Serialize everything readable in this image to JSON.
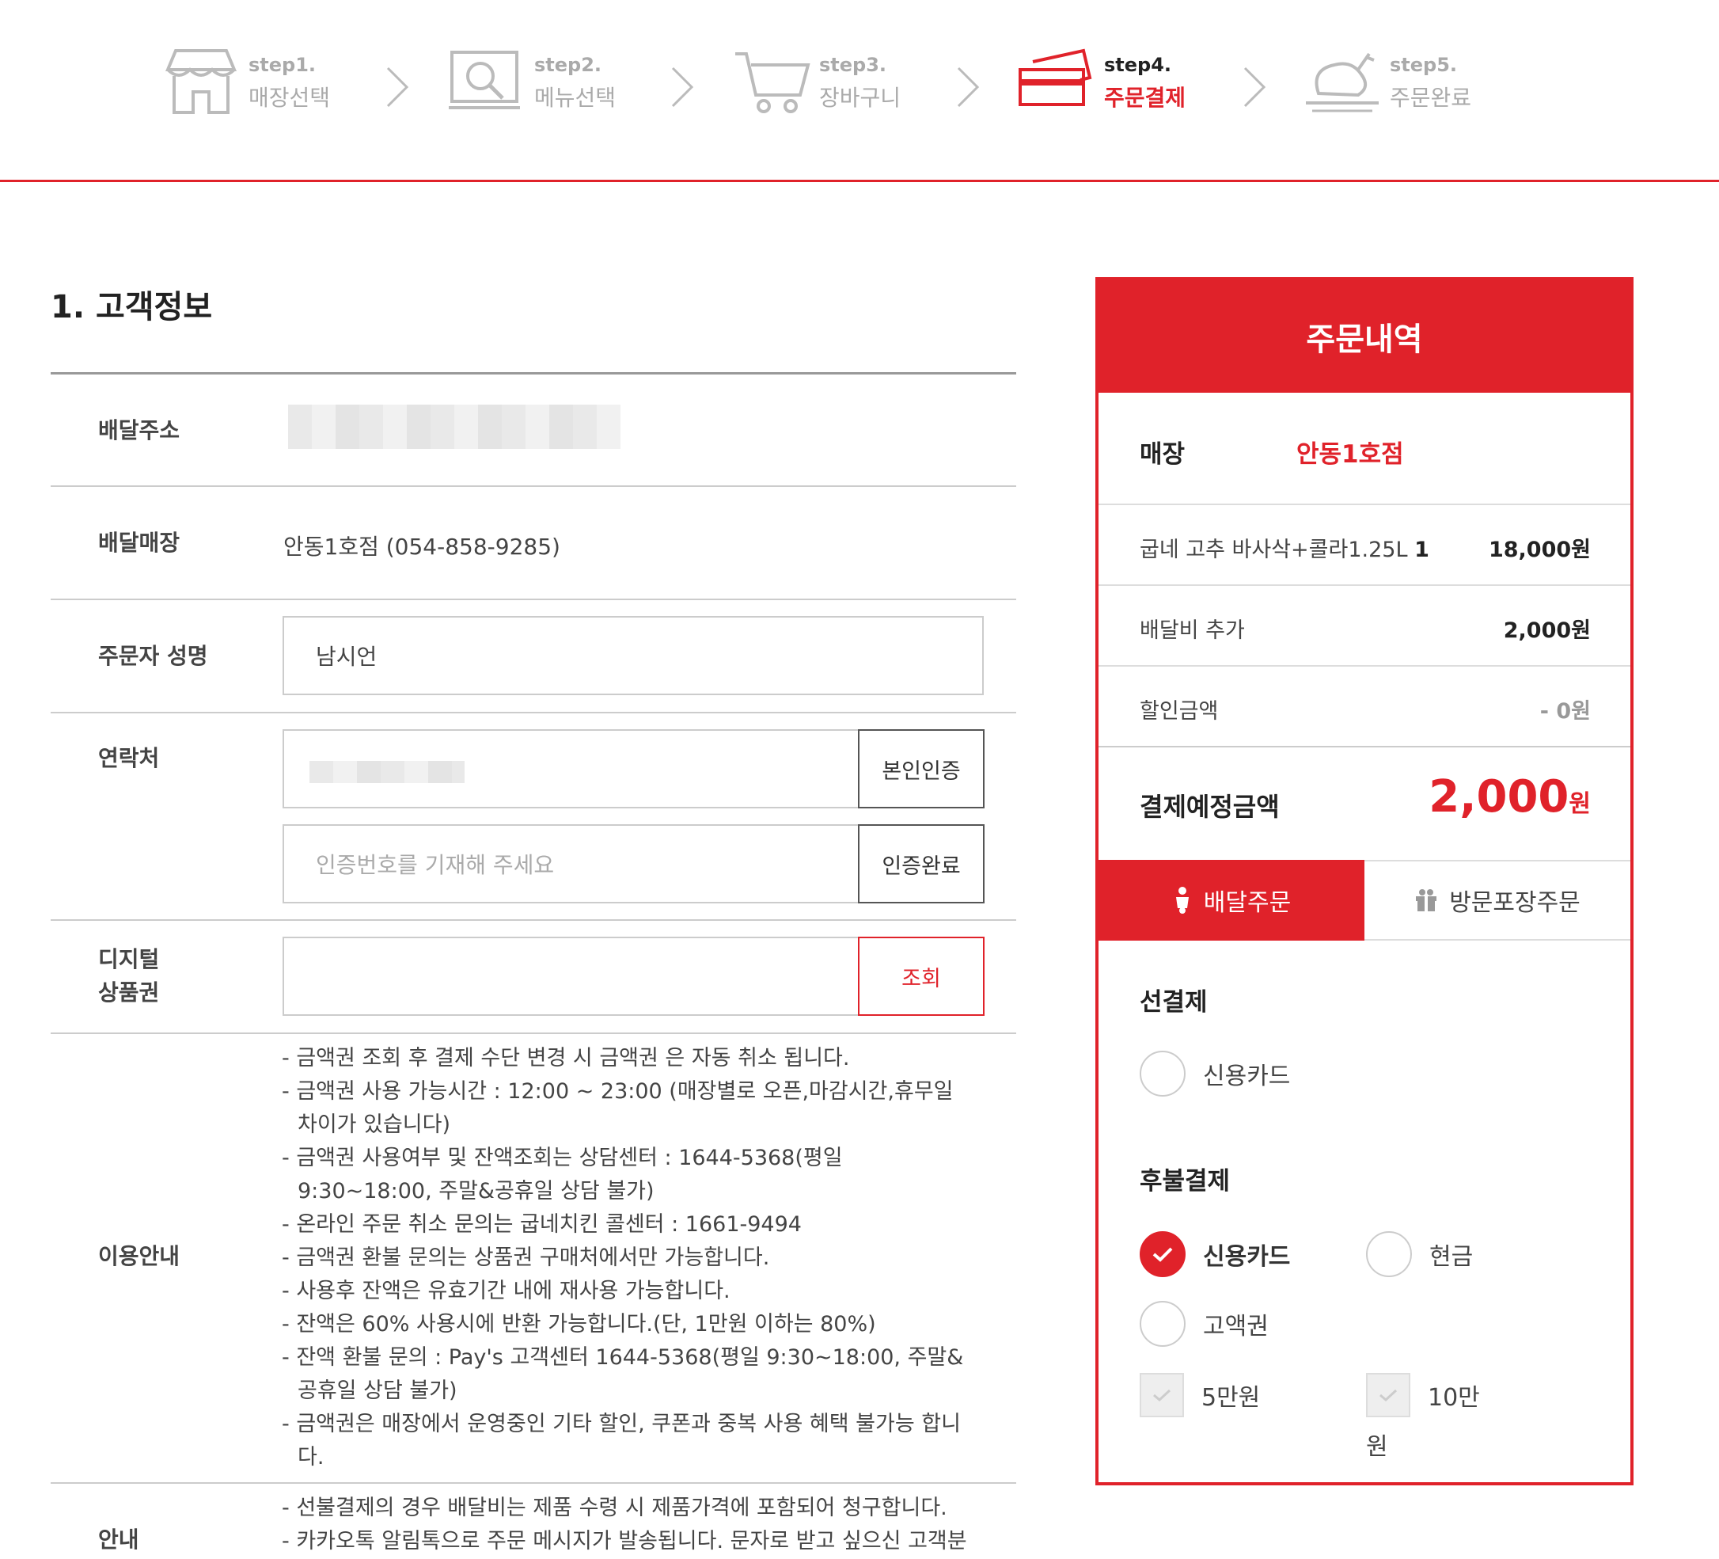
{
  "steps": [
    {
      "num": "step1.",
      "label": "매장선택"
    },
    {
      "num": "step2.",
      "label": "메뉴선택"
    },
    {
      "num": "step3.",
      "label": "장바구니"
    },
    {
      "num": "step4.",
      "label": "주문결제"
    },
    {
      "num": "step5.",
      "label": "주문완료"
    }
  ],
  "customer": {
    "title": "1. 고객정보",
    "address_label": "배달주소",
    "store_label": "배달매장",
    "store_value": "안동1호점 (054-858-9285)",
    "name_label": "주문자 성명",
    "name_value": "남시언",
    "contact_label": "연락처",
    "verify_btn": "본인인증",
    "code_placeholder": "인증번호를 기재해 주세요",
    "verify_done_btn": "인증완료",
    "gift_label_1": "디지털",
    "gift_label_2": "상품권",
    "gift_search_btn": "조회",
    "usage_label": "이용안내",
    "usage_lines": [
      "- 금액권 조회 후 결제 수단 변경 시 금액권 은 자동 취소 됩니다.",
      "- 금액권 사용 가능시간 : 12:00 ~ 23:00 (매장별로 오픈,마감시간,휴무일 차이가 있습니다)",
      "- 금액권 사용여부 및 잔액조회는 상담센터 : 1644-5368(평일 9:30~18:00, 주말&공휴일 상담 불가)",
      "- 온라인 주문 취소 문의는 굽네치킨 콜센터 : 1661-9494",
      "- 금액권 환불 문의는 상품권 구매처에서만 가능합니다.",
      "- 사용후 잔액은 유효기간 내에 재사용 가능합니다.",
      "- 잔액은 60% 사용시에 반환 가능합니다.(단, 1만원 이하는 80%)",
      "- 잔액 환불 문의 : Pay's 고객센터 1644-5368(평일 9:30~18:00, 주말&공휴일 상담 불가)",
      "- 금액권은 매장에서 운영중인 기타 할인, 쿠폰과 중복 사용 혜택 불가능 합니다."
    ],
    "guide_label": "안내",
    "guide_lines": [
      "- 선불결제의 경우 배달비는 제품 수령 시 제품가격에 포함되어 청구합니다.",
      "- 카카오톡 알림톡으로 주문 메시지가 발송됩니다. 문자로 받고 싶으신 고객분"
    ]
  },
  "order": {
    "title": "주문내역",
    "store_label": "매장",
    "store_value": "안동1호점",
    "item_name": "굽네 고추 바사삭+콜라1.25L",
    "item_qty": "1",
    "item_price": "18,000원",
    "delivery_label": "배달비 추가",
    "delivery_value": "2,000원",
    "discount_label": "할인금액",
    "discount_value": "- 0원",
    "total_label": "결제예정금액",
    "total_value": "2,000",
    "total_unit": "원",
    "tab_delivery": "배달주문",
    "tab_pickup": "방문포장주문",
    "prepay_title": "선결제",
    "prepay_card": "신용카드",
    "postpay_title": "후불결제",
    "postpay_card": "신용카드",
    "postpay_cash": "현금",
    "postpay_voucher": "고액권",
    "voucher_50k": "5만원",
    "voucher_100k_a": "10만",
    "voucher_100k_b": "원"
  },
  "colors": {
    "accent": "#e0222a"
  }
}
